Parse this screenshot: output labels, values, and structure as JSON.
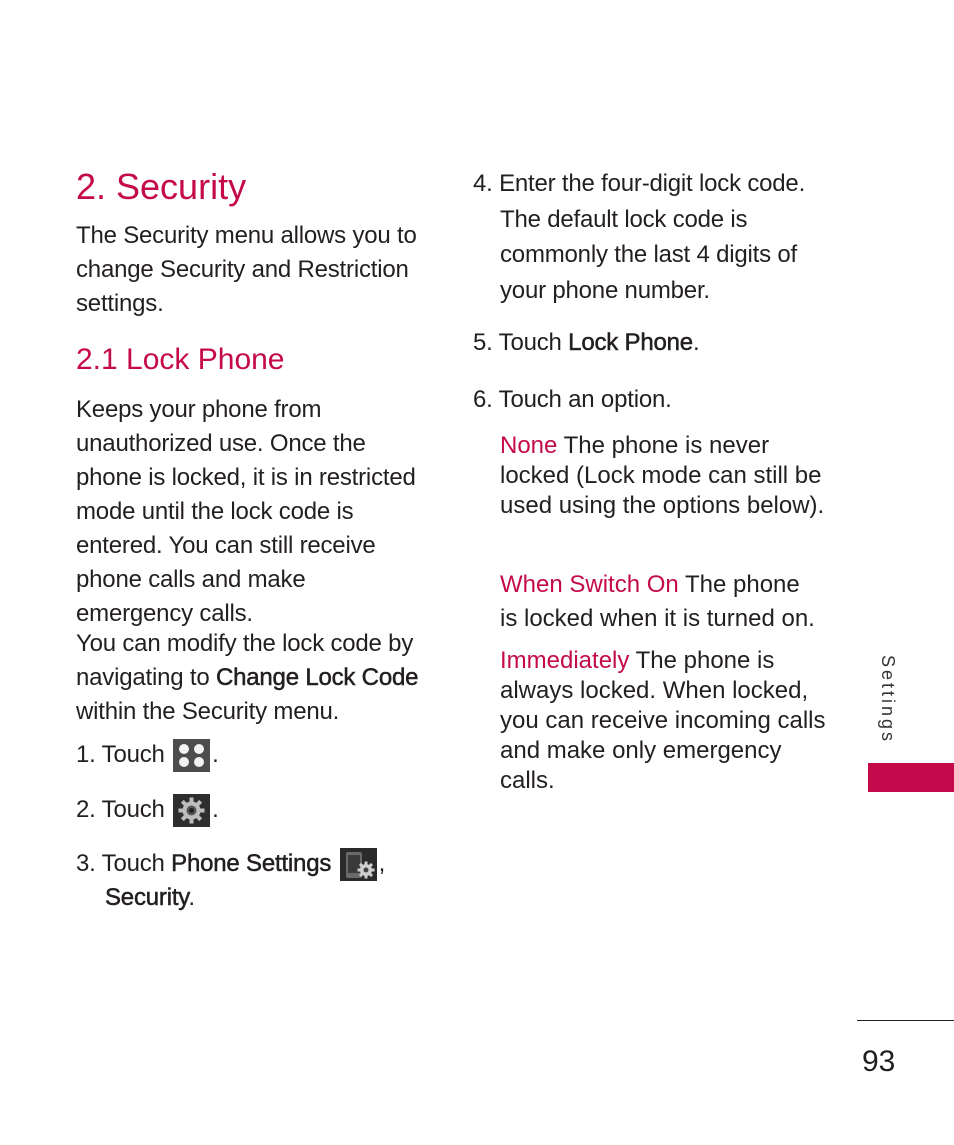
{
  "colors": {
    "accent": "#c40a4b",
    "text": "#231f20"
  },
  "left": {
    "title": "2. Security",
    "intro": "The Security menu allows you to change Security and Restriction settings.",
    "subtitle": "2.1 Lock Phone",
    "desc1": "Keeps your phone from unauthorized use. Once the phone is locked, it is in restricted mode until the lock code is entered. You can still receive phone calls and make emergency calls.",
    "desc2_pre": "You can modify the lock code by navigating to ",
    "desc2_bold": "Change Lock Code",
    "desc2_post": " within the Security menu.",
    "step1_pre": "1. Touch",
    "step1_icon": "apps-grid-icon",
    "step2_pre": "2. Touch",
    "step2_icon": "settings-gear-icon",
    "step3_pre": "3. Touch ",
    "step3_bold": "Phone Settings",
    "step3_icon": "phone-settings-icon",
    "step3_bold2": "Security",
    "period": ".",
    "comma": ","
  },
  "right": {
    "step4": "4. Enter the four-digit lock code.",
    "step4_detail": "The default lock code is commonly the last 4 digits of your phone number.",
    "step5_pre": "5. Touch ",
    "step5_bold": "Lock Phone",
    "step6": "6. Touch an option.",
    "options": [
      {
        "name": "None",
        "desc": " The phone is never locked (Lock mode can still be used using the options below)."
      },
      {
        "name": "When Switch On",
        "desc": " The phone is locked when it is turned on."
      },
      {
        "name": "Immediately",
        "desc": " The phone is always locked. When locked, you can receive incoming calls and make only emergency calls."
      }
    ]
  },
  "sidebar": {
    "section_label": "Settings"
  },
  "footer": {
    "page_number": "93"
  }
}
